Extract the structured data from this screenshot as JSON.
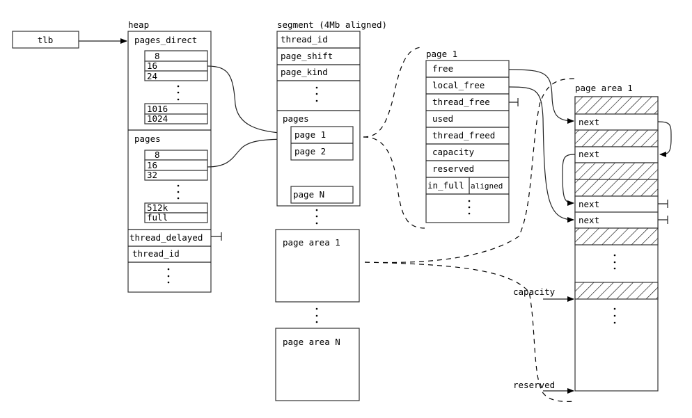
{
  "tlb": {
    "label": "tlb"
  },
  "heap": {
    "title": "heap",
    "pages_direct": {
      "label": "pages_direct",
      "entries": [
        "8",
        "16",
        "24",
        "1016",
        "1024"
      ]
    },
    "pages": {
      "label": "pages",
      "entries": [
        "8",
        "16",
        "32",
        "512k",
        "full"
      ]
    },
    "thread_delayed": "thread_delayed",
    "thread_id": "thread_id"
  },
  "segment": {
    "title": "segment (4Mb aligned)",
    "fields": [
      "thread_id",
      "page_shift",
      "page_kind"
    ],
    "pages_label": "pages",
    "pages": [
      "page 1",
      "page 2",
      "page N"
    ],
    "areas": [
      "page area 1",
      "page area N"
    ]
  },
  "page": {
    "title": "page 1",
    "fields": [
      "free",
      "local_free",
      "thread_free",
      "used",
      "thread_freed",
      "capacity",
      "reserved"
    ],
    "split": [
      "in_full",
      "aligned"
    ]
  },
  "page_area": {
    "title": "page area 1",
    "next_label": "next",
    "capacity_label": "capacity",
    "reserved_label": "reserved"
  }
}
